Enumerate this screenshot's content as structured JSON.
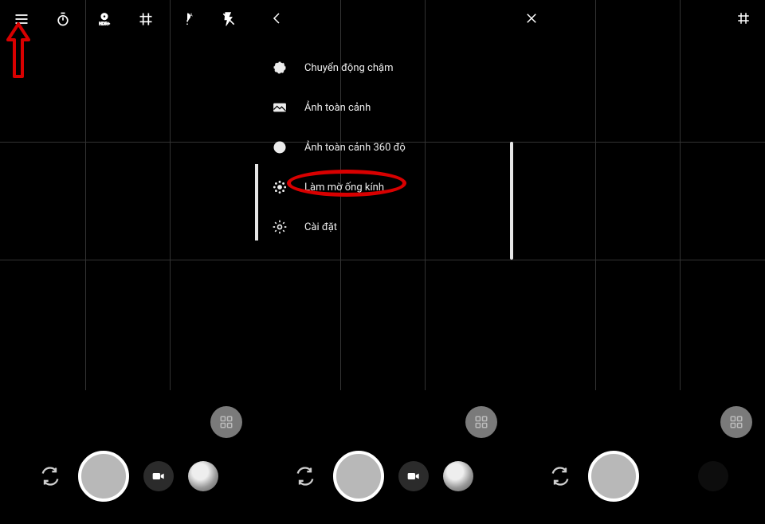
{
  "panels": {
    "left": {
      "topbar": {
        "menu": "menu",
        "timer": "timer",
        "hdr": "HDR+",
        "grid": "grid",
        "whitebalance": "AWB",
        "flash": "flash-off"
      }
    },
    "mid": {
      "back": "back",
      "menu": {
        "items": [
          {
            "icon": "motion",
            "label": "Chuyển động chậm"
          },
          {
            "icon": "panorama",
            "label": "Ảnh toàn cảnh"
          },
          {
            "icon": "sphere",
            "label": "Ảnh toàn cảnh 360 độ"
          },
          {
            "icon": "blur",
            "label": "Làm mờ ống kính"
          },
          {
            "icon": "settings",
            "label": "Cài đặt"
          }
        ],
        "highlighted_index": 3
      }
    },
    "right": {
      "close": "close",
      "grid": "grid"
    }
  },
  "bottom_controls": {
    "mode_switch": "modes",
    "switch_camera": "switch-camera",
    "shutter": "shutter",
    "video": "video",
    "thumbnail": "last-photo"
  },
  "annotations": {
    "arrow_target": "menu-icon",
    "circled_item": "Làm mờ ống kính"
  }
}
